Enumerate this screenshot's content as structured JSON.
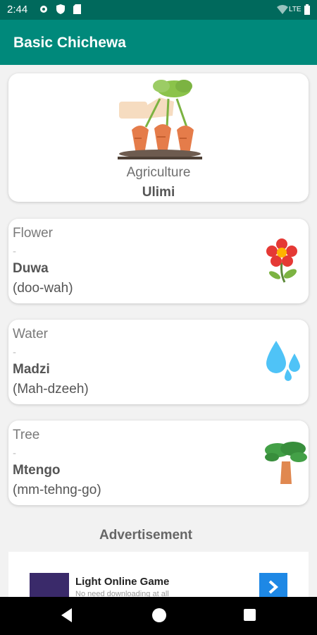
{
  "status": {
    "time": "2:44",
    "network": "LTE"
  },
  "app": {
    "title": "Basic Chichewa"
  },
  "category": {
    "label": "Agriculture",
    "value": "Ulimi",
    "icon": "carrots-harvest-icon"
  },
  "words": [
    {
      "english": "Flower",
      "dash": "-",
      "chichewa": "Duwa",
      "pronunciation": "(doo-wah)",
      "icon": "flower-icon"
    },
    {
      "english": "Water",
      "dash": "-",
      "chichewa": "Madzi",
      "pronunciation": "(Mah-dzeeh)",
      "icon": "water-drops-icon"
    },
    {
      "english": "Tree",
      "dash": "-",
      "chichewa": "Mtengo",
      "pronunciation": "(mm-tehng-go)",
      "icon": "tree-icon"
    }
  ],
  "advertisement": {
    "heading": "Advertisement",
    "title": "Light Online Game",
    "subtitle": "No need downloading at all"
  },
  "colors": {
    "status_bar": "#00695c",
    "app_bar": "#00897b",
    "background": "#f2f2f2"
  }
}
